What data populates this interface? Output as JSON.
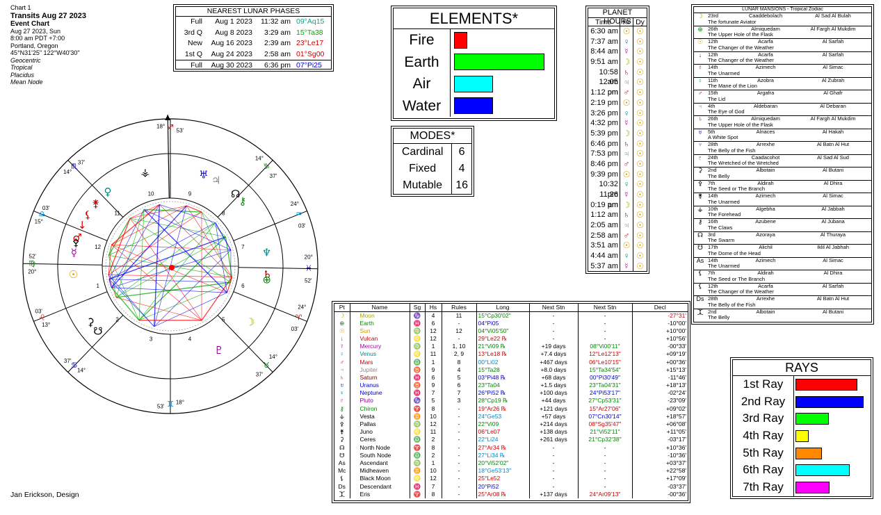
{
  "chart_info": {
    "chart_num": "Chart 1",
    "title": "Transits Aug 27 2023",
    "type": "Event Chart",
    "date": "Aug 27 2023, Sun",
    "time": "8:00 am  PDT +7:00",
    "place": "Portland, Oregon",
    "coords": "45°N31'25\"  122°W40'30\"",
    "opt1": "Geocentric",
    "opt2": "Tropical",
    "opt3": "Placidus",
    "opt4": "Mean Node"
  },
  "lunar": {
    "title": "NEAREST LUNAR PHASES",
    "rows": [
      {
        "phase": "Full",
        "date": "Aug 1 2023",
        "time": "11:32 am",
        "pos": "09°Aq15",
        "color": "#00aa88"
      },
      {
        "phase": "3rd Q",
        "date": "Aug 8 2023",
        "time": "3:29 am",
        "pos": "15°Ta38",
        "color": "#00aa00"
      },
      {
        "phase": "New",
        "date": "Aug 16 2023",
        "time": "2:39 am",
        "pos": "23°Le17",
        "color": "#cc0000"
      },
      {
        "phase": "1st Q",
        "date": "Aug 24 2023",
        "time": "2:58 am",
        "pos": "01°Sg00",
        "color": "#cc0000"
      },
      {
        "phase": "Full",
        "date": "Aug 30 2023",
        "time": "6:36 pm",
        "pos": "07°Pi25",
        "color": "#0000cc"
      }
    ]
  },
  "elements": {
    "title": "ELEMENTS*",
    "rows": [
      {
        "label": "Fire",
        "value": 1,
        "color": "#ff0000"
      },
      {
        "label": "Earth",
        "value": 7,
        "color": "#00ff00"
      },
      {
        "label": "Air",
        "value": 3,
        "color": "#00ffff"
      },
      {
        "label": "Water",
        "value": 3,
        "color": "#0000ff"
      }
    ]
  },
  "modes": {
    "title": "MODES*",
    "rows": [
      {
        "label": "Cardinal",
        "value": "6"
      },
      {
        "label": "Fixed",
        "value": "4"
      },
      {
        "label": "Mutable",
        "value": "16"
      }
    ]
  },
  "planet_hours": {
    "title": "PLANET HOURS",
    "col_time": "Time",
    "col_hr": "Hr",
    "col_dy": "Dy",
    "rows": [
      {
        "time": "6:30 am",
        "hr": "☉",
        "hc": "#cc9900"
      },
      {
        "time": "7:37 am",
        "hr": "♀",
        "hc": "#008888"
      },
      {
        "time": "8:44 am",
        "hr": "☿",
        "hc": "#aa00aa"
      },
      {
        "time": "9:51 am",
        "hr": "☽",
        "hc": "#aaaa00"
      },
      {
        "time": "10:58 am",
        "hr": "♄",
        "hc": "#880000"
      },
      {
        "time": "12:05 pm",
        "hr": "♃",
        "hc": "#888888"
      },
      {
        "time": "1:12 pm",
        "hr": "♂",
        "hc": "#cc0000"
      },
      {
        "time": "2:19 pm",
        "hr": "☉",
        "hc": "#cc9900"
      },
      {
        "time": "3:26 pm",
        "hr": "♀",
        "hc": "#008888"
      },
      {
        "time": "4:32 pm",
        "hr": "☿",
        "hc": "#aa00aa"
      },
      {
        "time": "5:39 pm",
        "hr": "☽",
        "hc": "#aaaa00"
      },
      {
        "time": "6:46 pm",
        "hr": "♄",
        "hc": "#880000"
      },
      {
        "time": "7:53 pm",
        "hr": "♃",
        "hc": "#888888"
      },
      {
        "time": "8:46 pm",
        "hr": "♂",
        "hc": "#cc0000"
      },
      {
        "time": "9:39 pm",
        "hr": "☉",
        "hc": "#cc9900"
      },
      {
        "time": "10:32 pm",
        "hr": "♀",
        "hc": "#008888"
      },
      {
        "time": "11:26 pm",
        "hr": "☿",
        "hc": "#aa00aa"
      },
      {
        "time": "0:19 am",
        "hr": "☽",
        "hc": "#aaaa00"
      },
      {
        "time": "1:12 am",
        "hr": "♄",
        "hc": "#880000"
      },
      {
        "time": "2:05 am",
        "hr": "♃",
        "hc": "#888888"
      },
      {
        "time": "2:58 am",
        "hr": "♂",
        "hc": "#cc0000"
      },
      {
        "time": "3:51 am",
        "hr": "☉",
        "hc": "#cc9900"
      },
      {
        "time": "4:44 am",
        "hr": "♀",
        "hc": "#008888"
      },
      {
        "time": "5:37 am",
        "hr": "☿",
        "hc": "#aa00aa"
      }
    ],
    "day_glyph": "☉",
    "day_color": "#cc9900"
  },
  "mansions": {
    "title": "LUNAR MANSIONS - Tropical Zodiac",
    "rows": [
      {
        "g": "☽",
        "gc": "#aaaa00",
        "n": "23rd",
        "a": "Caaddebolach",
        "r": "Al Sad Al Bulah",
        "d": "The fortunate Aviator"
      },
      {
        "g": "⊕",
        "gc": "#008800",
        "n": "26th",
        "a": "Almiquedam",
        "r": "Al Fargh Al Mukdim",
        "d": "The Upper Hole of the Flask"
      },
      {
        "g": "☉",
        "gc": "#cc9900",
        "n": "12th",
        "a": "Acarfa",
        "r": "Al Sarfah",
        "d": "The Changer of the Weather"
      },
      {
        "g": "↓",
        "gc": "#cc0000",
        "n": "12th",
        "a": "Acarfa",
        "r": "Al Sarfah",
        "d": "The Changer of the Weather"
      },
      {
        "g": "☿",
        "gc": "#aa00aa",
        "n": "14th",
        "a": "Azimech",
        "r": "Al Simac",
        "d": "The Unarmed"
      },
      {
        "g": "♀",
        "gc": "#008888",
        "n": "11th",
        "a": "Azobra",
        "r": "Al Zubrah",
        "d": "The Mane of the Lion"
      },
      {
        "g": "♂",
        "gc": "#cc0000",
        "n": "15th",
        "a": "Argafra",
        "r": "Al Ghafr",
        "d": "The Lid"
      },
      {
        "g": "♃",
        "gc": "#888888",
        "n": "4th",
        "a": "Aldebaran",
        "r": "Al Debaran",
        "d": "The Eye of God"
      },
      {
        "g": "♄",
        "gc": "#880000",
        "n": "26th",
        "a": "Almiquedam",
        "r": "Al Fargh Al Mukdim",
        "d": "The Upper Hole of the Flask"
      },
      {
        "g": "♅",
        "gc": "#0000cc",
        "n": "5th",
        "a": "Alnaces",
        "r": "Al Hakah",
        "d": "A White Spot"
      },
      {
        "g": "♆",
        "gc": "#008888",
        "n": "28th",
        "a": "Arrexhe",
        "r": "Al Batn Al Hut",
        "d": "The Belly of the Fish"
      },
      {
        "g": "♇",
        "gc": "#880088",
        "n": "24th",
        "a": "Caadacohot",
        "r": "Al Sad Al Sud",
        "d": "The Wretched of the Wretched"
      },
      {
        "g": "⚳",
        "gc": "#000000",
        "n": "2nd",
        "a": "Albotain",
        "r": "Al Butani",
        "d": "The Belly"
      },
      {
        "g": "⚴",
        "gc": "#000000",
        "n": "7th",
        "a": "Aldirah",
        "r": "Al Dhira",
        "d": "The Seed or The Branch"
      },
      {
        "g": "⚵",
        "gc": "#000000",
        "n": "14th",
        "a": "Azimech",
        "r": "Al Simac",
        "d": "The Unarmed"
      },
      {
        "g": "⚶",
        "gc": "#000000",
        "n": "10th",
        "a": "Algebha",
        "r": "Al Jabbah",
        "d": "The Forehead"
      },
      {
        "g": "⚷",
        "gc": "#000000",
        "n": "16th",
        "a": "Azubene",
        "r": "Al Jubana",
        "d": "The Claws"
      },
      {
        "g": "☊",
        "gc": "#000000",
        "n": "3rd",
        "a": "Azoraya",
        "r": "Al Thuraya",
        "d": "The Swarm"
      },
      {
        "g": "☋",
        "gc": "#000000",
        "n": "17th",
        "a": "Alichil",
        "r": "Iklil Al Jabhah",
        "d": "The Dome of the Head"
      },
      {
        "g": "As",
        "gc": "#000000",
        "n": "14th",
        "a": "Azimech",
        "r": "Al Simac",
        "d": "The Unarmed"
      },
      {
        "g": "⚸",
        "gc": "#000000",
        "n": "7th",
        "a": "Aldirah",
        "r": "Al Dhira",
        "d": "The Seed or The Branch"
      },
      {
        "g": "⚸",
        "gc": "#000000",
        "n": "12th",
        "a": "Acarfa",
        "r": "Al Sarfah",
        "d": "The Changer of the Weather"
      },
      {
        "g": "Ds",
        "gc": "#000000",
        "n": "28th",
        "a": "Arrexhe",
        "r": "Al Batn Al Hut",
        "d": "The Belly of the Fish"
      },
      {
        "g": "⯰",
        "gc": "#000000",
        "n": "2nd",
        "a": "Albotain",
        "r": "Al Butani",
        "d": "The Belly"
      }
    ]
  },
  "ptable": {
    "headers": [
      "Pt",
      "Name",
      "Sg",
      "Hs",
      "Rules",
      "Long",
      "Next Stn",
      "Next Stn",
      "Decl"
    ],
    "rows": [
      {
        "g": "☽",
        "gc": "#aaaa00",
        "name": "Moon",
        "nc": "#aaaa00",
        "sg": "♑",
        "sc": "#008800",
        "hs": "4",
        "rules": "11",
        "long": "15°Cp30'02\"",
        "lc": "#008800",
        "s1": "-",
        "s2": "-",
        "s2c": "#000",
        "decl": "-27°31'",
        "dc": "#cc0000"
      },
      {
        "g": "⊕",
        "gc": "#008800",
        "name": "Earth",
        "nc": "#008800",
        "sg": "♓",
        "sc": "#0000cc",
        "hs": "6",
        "rules": "-",
        "long": "04°Pi05",
        "lc": "#0000cc",
        "s1": "-",
        "s2": "-",
        "s2c": "#000",
        "decl": "-10°00'",
        "dc": "#000"
      },
      {
        "g": "☉",
        "gc": "#cc9900",
        "name": "Sun",
        "nc": "#cc9900",
        "sg": "♍",
        "sc": "#008800",
        "hs": "12",
        "rules": "12",
        "long": "04°Vi05'50\"",
        "lc": "#008800",
        "s1": "-",
        "s2": "-",
        "s2c": "#000",
        "decl": "+10°00'",
        "dc": "#000"
      },
      {
        "g": "↓",
        "gc": "#cc0000",
        "name": "Vulcan",
        "nc": "#cc0000",
        "sg": "♌",
        "sc": "#cc0000",
        "hs": "12",
        "rules": "-",
        "long": "29°Le22 ℞",
        "lc": "#cc0000",
        "s1": "-",
        "s2": "-",
        "s2c": "#000",
        "decl": "+10°56'",
        "dc": "#000"
      },
      {
        "g": "☿",
        "gc": "#aa00aa",
        "name": "Mercury",
        "nc": "#aa00aa",
        "sg": "♍",
        "sc": "#008800",
        "hs": "1",
        "rules": "1, 10",
        "long": "21°Vi09 ℞",
        "lc": "#008800",
        "s1": "+19 days",
        "s2": "08°Vi00'11\"",
        "s2c": "#008800",
        "decl": "-00°33'",
        "dc": "#000"
      },
      {
        "g": "♀",
        "gc": "#008888",
        "name": "Venus",
        "nc": "#008888",
        "sg": "♌",
        "sc": "#cc0000",
        "hs": "11",
        "rules": "2, 9",
        "long": "13°Le18 ℞",
        "lc": "#cc0000",
        "s1": "+7.4 days",
        "s2": "12°Le12'13\"",
        "s2c": "#cc0000",
        "decl": "+09°19'",
        "dc": "#000"
      },
      {
        "g": "♂",
        "gc": "#cc0000",
        "name": "Mars",
        "nc": "#cc0000",
        "sg": "♎",
        "sc": "#0088cc",
        "hs": "1",
        "rules": "8",
        "long": "00°Li02",
        "lc": "#0088cc",
        "s1": "+467 days",
        "s2": "06°Le10'15\"",
        "s2c": "#cc0000",
        "decl": "+00°36'",
        "dc": "#000"
      },
      {
        "g": "♃",
        "gc": "#888888",
        "name": "Jupiter",
        "nc": "#888888",
        "sg": "♉",
        "sc": "#008800",
        "hs": "9",
        "rules": "4",
        "long": "15°Ta28",
        "lc": "#008800",
        "s1": "+8.0 days",
        "s2": "15°Ta34'54\"",
        "s2c": "#008800",
        "decl": "+15°13'",
        "dc": "#000"
      },
      {
        "g": "♄",
        "gc": "#880000",
        "name": "Saturn",
        "nc": "#880000",
        "sg": "♓",
        "sc": "#0000cc",
        "hs": "6",
        "rules": "5",
        "long": "03°Pi48 ℞",
        "lc": "#0000cc",
        "s1": "+68 days",
        "s2": "00°Pi30'49\"",
        "s2c": "#0000cc",
        "decl": "-11°46'",
        "dc": "#000"
      },
      {
        "g": "♅",
        "gc": "#0000cc",
        "name": "Uranus",
        "nc": "#0000cc",
        "sg": "♉",
        "sc": "#008800",
        "hs": "9",
        "rules": "6",
        "long": "23°Ta04",
        "lc": "#008800",
        "s1": "+1.5 days",
        "s2": "23°Ta04'31\"",
        "s2c": "#008800",
        "decl": "+18°13'",
        "dc": "#000"
      },
      {
        "g": "♆",
        "gc": "#008888",
        "name": "Neptune",
        "nc": "#0000cc",
        "sg": "♓",
        "sc": "#0000cc",
        "hs": "7",
        "rules": "7",
        "long": "26°Pi52 ℞",
        "lc": "#0000cc",
        "s1": "+100 days",
        "s2": "24°Pi53'17\"",
        "s2c": "#0000cc",
        "decl": "-02°24'",
        "dc": "#000"
      },
      {
        "g": "♇",
        "gc": "#880088",
        "name": "Pluto",
        "nc": "#880088",
        "sg": "♑",
        "sc": "#008800",
        "hs": "5",
        "rules": "3",
        "long": "28°Cp19 ℞",
        "lc": "#008800",
        "s1": "+44 days",
        "s2": "27°Cp53'31\"",
        "s2c": "#008800",
        "decl": "-23°09'",
        "dc": "#000"
      },
      {
        "g": "⚷",
        "gc": "#008800",
        "name": "Chiron",
        "nc": "#008800",
        "sg": "♈",
        "sc": "#cc0000",
        "hs": "8",
        "rules": "-",
        "long": "19°Ar26 ℞",
        "lc": "#cc0000",
        "s1": "+121 days",
        "s2": "15°Ar27'06\"",
        "s2c": "#cc0000",
        "decl": "+09°02'",
        "dc": "#000"
      },
      {
        "g": "⚶",
        "gc": "#000",
        "name": "Vesta",
        "nc": "#000",
        "sg": "♊",
        "sc": "#0088cc",
        "hs": "10",
        "rules": "-",
        "long": "24°Ge53",
        "lc": "#0088cc",
        "s1": "+57 days",
        "s2": "07°Cn30'14\"",
        "s2c": "#0000cc",
        "decl": "+18°57'",
        "dc": "#000"
      },
      {
        "g": "⚴",
        "gc": "#000",
        "name": "Pallas",
        "nc": "#000",
        "sg": "♍",
        "sc": "#008800",
        "hs": "12",
        "rules": "-",
        "long": "22°Vi09",
        "lc": "#008800",
        "s1": "+214 days",
        "s2": "08°Sg35'47\"",
        "s2c": "#cc0000",
        "decl": "+06°08'",
        "dc": "#000"
      },
      {
        "g": "⚵",
        "gc": "#000",
        "name": "Juno",
        "nc": "#000",
        "sg": "♌",
        "sc": "#cc0000",
        "hs": "11",
        "rules": "-",
        "long": "06°Le07",
        "lc": "#cc0000",
        "s1": "+138 days",
        "s2": "21°Vi52'11\"",
        "s2c": "#008800",
        "decl": "+11°05'",
        "dc": "#000"
      },
      {
        "g": "⚳",
        "gc": "#000",
        "name": "Ceres",
        "nc": "#000",
        "sg": "♎",
        "sc": "#0088cc",
        "hs": "2",
        "rules": "-",
        "long": "22°Li24",
        "lc": "#0088cc",
        "s1": "+261 days",
        "s2": "21°Cp32'38\"",
        "s2c": "#008800",
        "decl": "-03°17'",
        "dc": "#000"
      },
      {
        "g": "☊",
        "gc": "#000",
        "name": "North Node",
        "nc": "#000",
        "sg": "♈",
        "sc": "#cc0000",
        "hs": "8",
        "rules": "-",
        "long": "27°Ar34 ℞",
        "lc": "#cc0000",
        "s1": "-",
        "s2": "-",
        "s2c": "#000",
        "decl": "+10°36'",
        "dc": "#000"
      },
      {
        "g": "☋",
        "gc": "#000",
        "name": "South Node",
        "nc": "#000",
        "sg": "♎",
        "sc": "#0088cc",
        "hs": "2",
        "rules": "-",
        "long": "27°Li34 ℞",
        "lc": "#0088cc",
        "s1": "-",
        "s2": "-",
        "s2c": "#000",
        "decl": "-10°36'",
        "dc": "#000"
      },
      {
        "g": "As",
        "gc": "#000",
        "name": "Ascendant",
        "nc": "#000",
        "sg": "♍",
        "sc": "#008800",
        "hs": "1",
        "rules": "-",
        "long": "20°Vi52'02\"",
        "lc": "#008800",
        "s1": "-",
        "s2": "-",
        "s2c": "#000",
        "decl": "+03°37'",
        "dc": "#000"
      },
      {
        "g": "Mc",
        "gc": "#000",
        "name": "Midheaven",
        "nc": "#000",
        "sg": "♊",
        "sc": "#0088cc",
        "hs": "10",
        "rules": "-",
        "long": "18°Ge53'13\"",
        "lc": "#0088cc",
        "s1": "-",
        "s2": "-",
        "s2c": "#000",
        "decl": "+22°58'",
        "dc": "#000"
      },
      {
        "g": "⚸",
        "gc": "#000",
        "name": "Black Moon",
        "nc": "#000",
        "sg": "♌",
        "sc": "#cc0000",
        "hs": "12",
        "rules": "-",
        "long": "25°Le52",
        "lc": "#cc0000",
        "s1": "-",
        "s2": "-",
        "s2c": "#000",
        "decl": "+17°09'",
        "dc": "#000"
      },
      {
        "g": "Ds",
        "gc": "#000",
        "name": "Descendant",
        "nc": "#000",
        "sg": "♓",
        "sc": "#0000cc",
        "hs": "7",
        "rules": "-",
        "long": "20°Pi52",
        "lc": "#0000cc",
        "s1": "-",
        "s2": "-",
        "s2c": "#000",
        "decl": "-03°37'",
        "dc": "#000"
      },
      {
        "g": "⯰",
        "gc": "#000",
        "name": "Eris",
        "nc": "#000",
        "sg": "♈",
        "sc": "#cc0000",
        "hs": "8",
        "rules": "-",
        "long": "25°Ar08 ℞",
        "lc": "#cc0000",
        "s1": "+137 days",
        "s2": "24°Ar09'13\"",
        "s2c": "#cc0000",
        "decl": "-00°36'",
        "dc": "#000"
      }
    ]
  },
  "rays": {
    "title": "RAYS",
    "rows": [
      {
        "label": "1st Ray",
        "value": 0.84,
        "color": "#ff0000"
      },
      {
        "label": "2nd Ray",
        "value": 0.92,
        "color": "#0000ff"
      },
      {
        "label": "3rd Ray",
        "value": 0.45,
        "color": "#00ff00"
      },
      {
        "label": "4th Ray",
        "value": 0.18,
        "color": "#ffff00"
      },
      {
        "label": "5th Ray",
        "value": 0.36,
        "color": "#ff8800"
      },
      {
        "label": "6th Ray",
        "value": 0.74,
        "color": "#00ffff"
      },
      {
        "label": "7th Ray",
        "value": 0.46,
        "color": "#ff00ff"
      }
    ]
  },
  "wheel": {
    "cusp_degrees": [
      {
        "deg": "18°",
        "sign": "♊",
        "min": "53'",
        "sc": "#0088cc"
      },
      {
        "deg": "14°",
        "sign": "♋",
        "min": "37'",
        "sc": "#0000cc"
      },
      {
        "deg": "13°",
        "sign": "♌",
        "min": "03'",
        "sc": "#cc0000"
      },
      {
        "deg": "20°",
        "sign": "♍",
        "min": "52'",
        "sc": "#008800"
      },
      {
        "deg": "15°",
        "sign": "♎",
        "min": "03'",
        "sc": "#0088cc"
      },
      {
        "deg": "14°",
        "sign": "♏",
        "min": "37'",
        "sc": "#0000cc"
      },
      {
        "deg": "18°",
        "sign": "♐",
        "min": "53'",
        "sc": "#cc0000"
      },
      {
        "deg": "14°",
        "sign": "♑",
        "min": "37'",
        "sc": "#008800"
      },
      {
        "deg": "24°",
        "sign": "♒",
        "min": "03'",
        "sc": "#0088cc"
      },
      {
        "deg": "20°",
        "sign": "♓",
        "min": "52'",
        "sc": "#0000cc"
      },
      {
        "deg": "24°",
        "sign": "♈",
        "min": "03'",
        "sc": "#cc0000"
      },
      {
        "deg": "14°",
        "sign": "♉",
        "min": "37'",
        "sc": "#008800"
      }
    ],
    "house_numbers": [
      "1",
      "2",
      "3",
      "4",
      "5",
      "6",
      "7",
      "8",
      "9",
      "10",
      "11",
      "12"
    ]
  },
  "credit": "Jan Erickson, Design"
}
